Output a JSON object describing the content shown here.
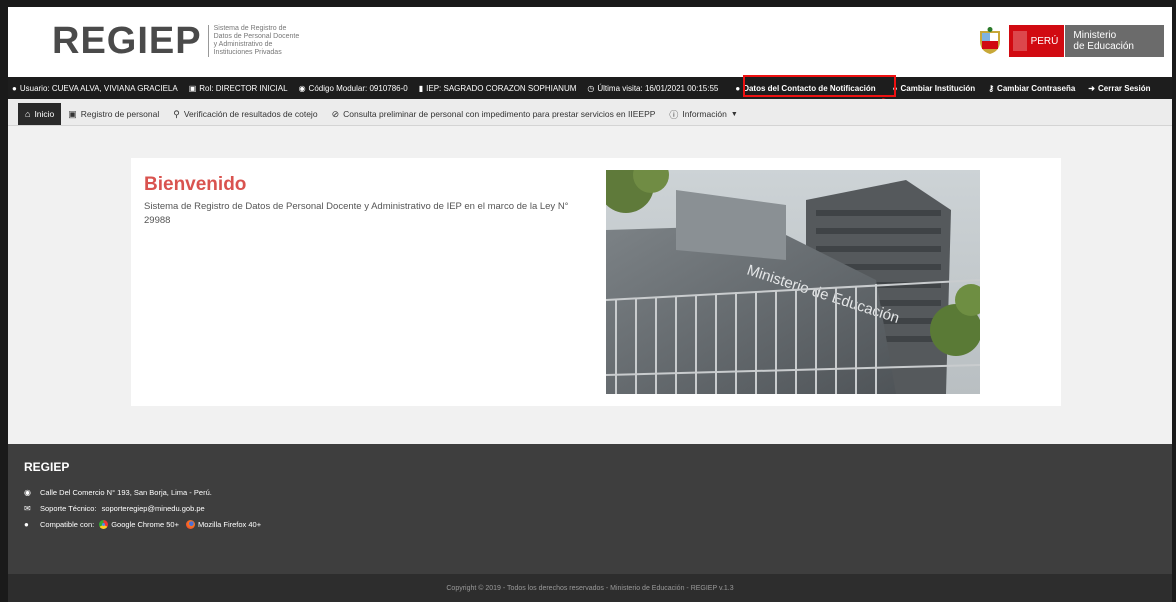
{
  "header": {
    "logo_text": "REGIEP",
    "logo_subtitle": "Sistema de Registro de Datos de Personal Docente y Administrativo de Instituciones Privadas",
    "peru_label": "PERÚ",
    "ministry_line1": "Ministerio",
    "ministry_line2": "de Educación"
  },
  "userbar": {
    "usuario": "Usuario: CUEVA ALVA, VIVIANA GRACIELA",
    "rol": "Rol: DIRECTOR INICIAL",
    "codigo_modular": "Código Modular: 0910786-0",
    "iep": "IEP: SAGRADO CORAZON SOPHIANUM",
    "ultima_visita": "Última visita: 16/01/2021 00:15:55",
    "contacto": "Datos del Contacto de Notificación",
    "cambiar_institucion": "Cambiar Institución",
    "cambiar_contrasena": "Cambiar Contraseña",
    "cerrar_sesion": "Cerrar Sesión"
  },
  "nav": {
    "inicio": "Inicio",
    "registro": "Registro de personal",
    "verificacion": "Verificación de resultados de cotejo",
    "consulta": "Consulta preliminar de personal con impedimento para prestar servicios en IIEEPP",
    "informacion": "Información"
  },
  "main": {
    "title": "Bienvenido",
    "text": "Sistema de Registro de Datos de Personal Docente y Administrativo de IEP en el marco de la Ley N° 29988",
    "photo_sign": "Ministerio de Educación"
  },
  "footer": {
    "brand": "REGIEP",
    "address": "Calle Del Comercio N° 193, San Borja, Lima - Perú.",
    "soporte_label": "Soporte Técnico:",
    "soporte_email": "soporteregiep@minedu.gob.pe",
    "compatible_label": "Compatible con:",
    "chrome": "Google Chrome 50+",
    "firefox": "Mozilla Firefox 40+",
    "copyright": "Copyright © 2019 - Todos los derechos reservados - Ministerio de Educación - REGIEP v.1.3"
  },
  "colors": {
    "accent_red": "#d9534f",
    "highlight_red": "#ee1111",
    "dark_bar": "#1d1d1d",
    "footer_bg": "#3e3e3e"
  }
}
